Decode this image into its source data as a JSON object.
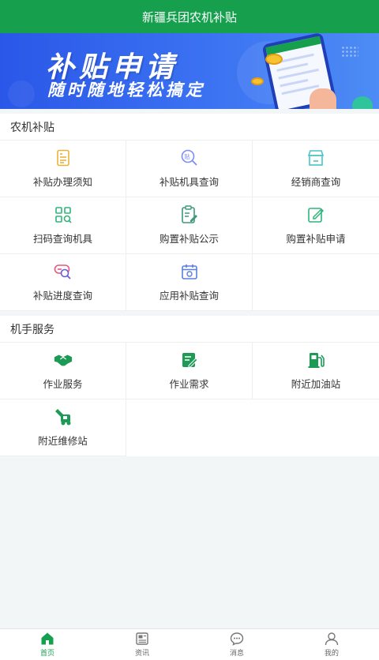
{
  "app": {
    "title": "新疆兵团农机补贴"
  },
  "banner": {
    "title": "补贴申请",
    "subtitle": "随时随地轻松搞定"
  },
  "sections": [
    {
      "title": "农机补贴",
      "items": [
        {
          "label": "补贴办理须知",
          "icon": "document-icon"
        },
        {
          "label": "补贴机具查询",
          "icon": "subsidy-search-icon"
        },
        {
          "label": "经销商查询",
          "icon": "store-icon"
        },
        {
          "label": "扫码查询机具",
          "icon": "scan-grid-icon"
        },
        {
          "label": "购置补贴公示",
          "icon": "clipboard-edit-icon"
        },
        {
          "label": "购置补贴申请",
          "icon": "edit-square-icon"
        },
        {
          "label": "补贴进度查询",
          "icon": "progress-search-icon"
        },
        {
          "label": "应用补贴查询",
          "icon": "calendar-icon"
        }
      ]
    },
    {
      "title": "机手服务",
      "items": [
        {
          "label": "作业服务",
          "icon": "handshake-icon"
        },
        {
          "label": "作业需求",
          "icon": "request-edit-icon"
        },
        {
          "label": "附近加油站",
          "icon": "gas-station-icon"
        },
        {
          "label": "附近维修站",
          "icon": "repair-icon"
        }
      ]
    }
  ],
  "tabbar": [
    {
      "label": "首页",
      "icon": "home-icon",
      "active": true
    },
    {
      "label": "资讯",
      "icon": "news-icon",
      "active": false
    },
    {
      "label": "消息",
      "icon": "message-icon",
      "active": false
    },
    {
      "label": "我的",
      "icon": "profile-icon",
      "active": false
    }
  ],
  "colors": {
    "primary": "#16a04e",
    "banner": "#3b72f2",
    "background": "#f3f6f6"
  }
}
